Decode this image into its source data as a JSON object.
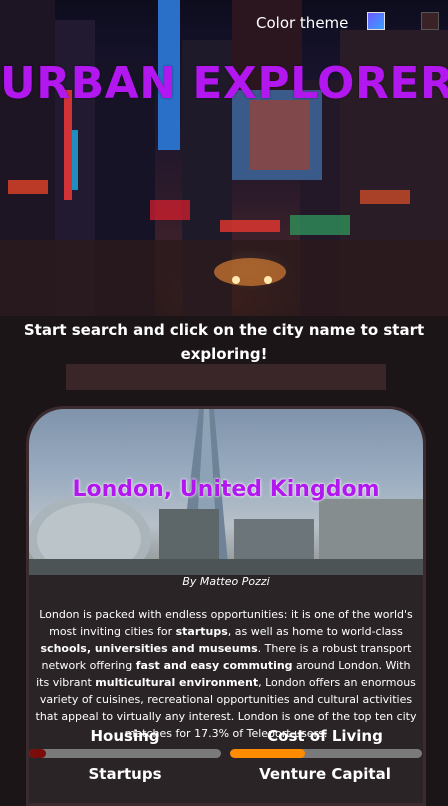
{
  "header": {
    "theme_label": "Color theme",
    "title": "URBAN EXPLORER"
  },
  "search": {
    "prompt": "Start search and click on the city name to start exploring!",
    "value": ""
  },
  "city": {
    "name": "London, United Kingdom",
    "author": "By Matteo Pozzi",
    "summary": [
      {
        "t": "London is packed with endless opportunities: it is one of the world's most inviting cities for ",
        "b": false
      },
      {
        "t": "startups",
        "b": true
      },
      {
        "t": ", as well as home to world-class ",
        "b": false
      },
      {
        "t": "schools, universities and museums",
        "b": true
      },
      {
        "t": ". There is a robust transport network offering ",
        "b": false
      },
      {
        "t": "fast and easy commuting",
        "b": true
      },
      {
        "t": " around London. With its vibrant ",
        "b": false
      },
      {
        "t": "multicultural environment",
        "b": true
      },
      {
        "t": ", London offers an enormous variety of cuisines, recreational opportunities and cultural activities that appeal to virtually any interest. London is one of the top ten city matches for 17.3% of Teleport users.",
        "b": false
      }
    ],
    "scores": [
      {
        "label": "Housing",
        "fraction": 0.09,
        "color": "#7a0c0c"
      },
      {
        "label": "Cost of Living",
        "fraction": 0.39,
        "color": "#ff8c00"
      }
    ],
    "next_scores": [
      "Startups",
      "Venture Capital"
    ]
  },
  "colors": {
    "accent": "#b217f0",
    "background": "#1c1517"
  }
}
